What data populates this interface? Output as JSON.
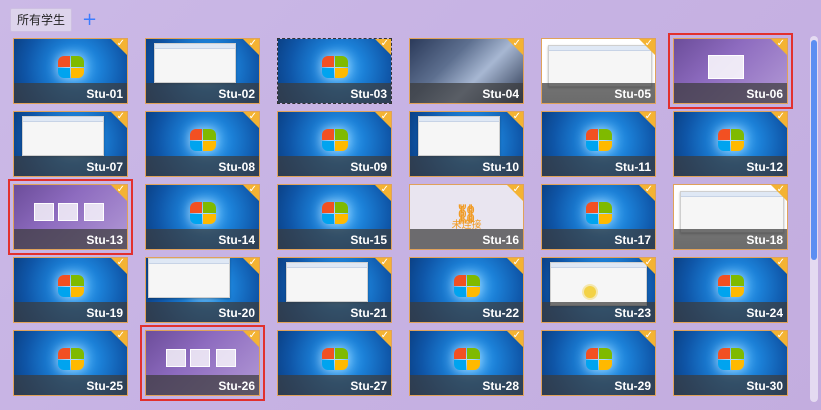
{
  "toolbar": {
    "all_students_tab": "所有学生",
    "add_label": "+"
  },
  "offline_text": "未连接",
  "students": [
    {
      "label": "Stu-01",
      "screen": "win7",
      "highlight": false,
      "dashed": false
    },
    {
      "label": "Stu-02",
      "screen": "win7",
      "highlight": false,
      "dashed": false
    },
    {
      "label": "Stu-03",
      "screen": "win7",
      "highlight": false,
      "dashed": true
    },
    {
      "label": "Stu-04",
      "screen": "anime",
      "highlight": false,
      "dashed": false
    },
    {
      "label": "Stu-05",
      "screen": "whitepage",
      "highlight": false,
      "dashed": false
    },
    {
      "label": "Stu-06",
      "screen": "login",
      "highlight": true,
      "dashed": false
    },
    {
      "label": "Stu-07",
      "screen": "win7",
      "highlight": false,
      "dashed": false
    },
    {
      "label": "Stu-08",
      "screen": "win7",
      "highlight": false,
      "dashed": false
    },
    {
      "label": "Stu-09",
      "screen": "win7",
      "highlight": false,
      "dashed": false
    },
    {
      "label": "Stu-10",
      "screen": "win7",
      "highlight": false,
      "dashed": false
    },
    {
      "label": "Stu-11",
      "screen": "win7",
      "highlight": false,
      "dashed": false
    },
    {
      "label": "Stu-12",
      "screen": "win7",
      "highlight": false,
      "dashed": false
    },
    {
      "label": "Stu-13",
      "screen": "login",
      "highlight": true,
      "dashed": false
    },
    {
      "label": "Stu-14",
      "screen": "win7",
      "highlight": false,
      "dashed": false
    },
    {
      "label": "Stu-15",
      "screen": "win7",
      "highlight": false,
      "dashed": false
    },
    {
      "label": "Stu-16",
      "screen": "offline",
      "highlight": false,
      "dashed": false
    },
    {
      "label": "Stu-17",
      "screen": "win7",
      "highlight": false,
      "dashed": false
    },
    {
      "label": "Stu-18",
      "screen": "whitepage",
      "highlight": false,
      "dashed": false
    },
    {
      "label": "Stu-19",
      "screen": "win7",
      "highlight": false,
      "dashed": false
    },
    {
      "label": "Stu-20",
      "screen": "win7",
      "highlight": false,
      "dashed": false
    },
    {
      "label": "Stu-21",
      "screen": "win7",
      "highlight": false,
      "dashed": false
    },
    {
      "label": "Stu-22",
      "screen": "win7",
      "highlight": false,
      "dashed": false
    },
    {
      "label": "Stu-23",
      "screen": "win7",
      "highlight": false,
      "dashed": false
    },
    {
      "label": "Stu-24",
      "screen": "win7",
      "highlight": false,
      "dashed": false
    },
    {
      "label": "Stu-25",
      "screen": "win7",
      "highlight": false,
      "dashed": false
    },
    {
      "label": "Stu-26",
      "screen": "login",
      "highlight": true,
      "dashed": false
    },
    {
      "label": "Stu-27",
      "screen": "win7",
      "highlight": false,
      "dashed": false
    },
    {
      "label": "Stu-28",
      "screen": "win7",
      "highlight": false,
      "dashed": false
    },
    {
      "label": "Stu-29",
      "screen": "win7",
      "highlight": false,
      "dashed": false
    },
    {
      "label": "Stu-30",
      "screen": "win7",
      "highlight": false,
      "dashed": false
    }
  ]
}
